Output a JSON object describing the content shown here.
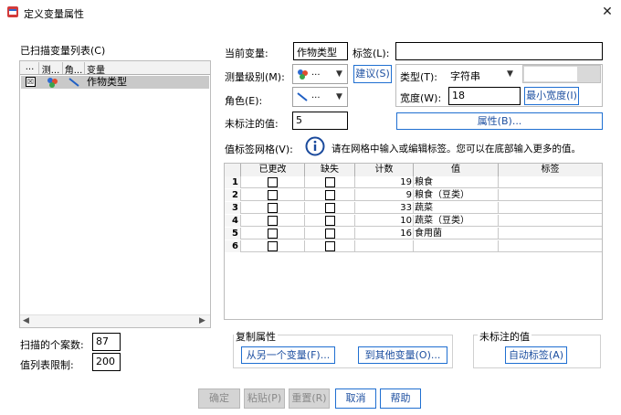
{
  "window": {
    "title": "定义变量属性"
  },
  "left_panel": {
    "title": "已扫描变量列表(C)",
    "columns": [
      "...",
      "测...",
      "角...",
      "变量"
    ],
    "rows": [
      {
        "name": "作物类型"
      }
    ],
    "cases_label": "扫描的个案数:",
    "cases_value": "87",
    "limit_label": "值列表限制:",
    "limit_value": "200"
  },
  "props": {
    "current_var_label": "当前变量:",
    "current_var_value": "作物类型",
    "label_label": "标签(L):",
    "label_value": "",
    "measure_label": "测量级别(M):",
    "measure_value": "...",
    "suggest_button": "建议(S)",
    "type_label": "类型(T):",
    "type_value": "字符串",
    "width_label": "宽度(W):",
    "width_value": "18",
    "min_width_button": "最小宽度(I)",
    "role_label": "角色(E):",
    "role_value": "...",
    "unlabeled_label": "未标注的值:",
    "unlabeled_value": "5",
    "attributes_button": "属性(B)..."
  },
  "grid": {
    "label": "值标签网格(V):",
    "info_text": "请在网格中输入或编辑标签。您可以在底部输入更多的值。",
    "headers": [
      "已更改",
      "缺失",
      "计数",
      "值",
      "标签"
    ],
    "rows": [
      {
        "num": "1",
        "count": "19",
        "value": "粮食",
        "label": ""
      },
      {
        "num": "2",
        "count": "9",
        "value": "粮食（豆类）",
        "label": ""
      },
      {
        "num": "3",
        "count": "33",
        "value": "蔬菜",
        "label": ""
      },
      {
        "num": "4",
        "count": "10",
        "value": "蔬菜（豆类）",
        "label": ""
      },
      {
        "num": "5",
        "count": "16",
        "value": "食用菌",
        "label": ""
      },
      {
        "num": "6",
        "count": "",
        "value": "",
        "label": ""
      }
    ]
  },
  "copy_group": {
    "title": "复制属性",
    "from_button": "从另一个变量(F)...",
    "to_button": "到其他变量(O)..."
  },
  "unlabeled_group": {
    "title": "未标注的值",
    "auto_button": "自动标签(A)"
  },
  "footer": {
    "ok": "确定",
    "paste": "粘贴(P)",
    "reset": "重置(R)",
    "cancel": "取消",
    "help": "帮助"
  },
  "icons": {
    "app": "spss-app-icon",
    "close": "close-icon",
    "info": "info-icon",
    "nominal": "nominal-measure-icon",
    "role": "input-role-icon"
  },
  "colors": {
    "accent": "#1f6fd1",
    "selected_row": "#c9c9c9",
    "info_icon": "#1a4a9c"
  }
}
